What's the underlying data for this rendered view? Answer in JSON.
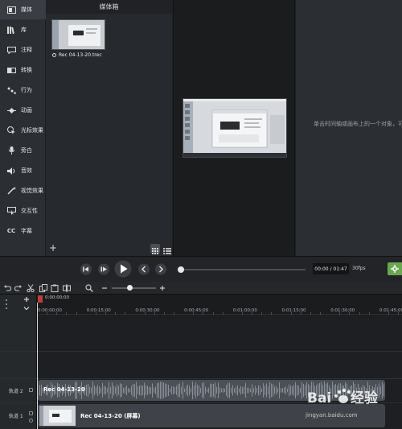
{
  "sidebar": {
    "items": [
      {
        "label": "媒体",
        "icon": "media-icon",
        "active": true
      },
      {
        "label": "库",
        "icon": "library-icon"
      },
      {
        "label": "注释",
        "icon": "annotation-icon"
      },
      {
        "label": "转换",
        "icon": "transition-icon"
      },
      {
        "label": "行为",
        "icon": "behavior-icon"
      },
      {
        "label": "动画",
        "icon": "animation-icon"
      },
      {
        "label": "光标效果",
        "icon": "cursor-effect-icon"
      },
      {
        "label": "旁白",
        "icon": "microphone-icon"
      },
      {
        "label": "音效",
        "icon": "speaker-icon"
      },
      {
        "label": "视觉效果",
        "icon": "magic-wand-icon"
      },
      {
        "label": "交互性",
        "icon": "interactivity-icon"
      },
      {
        "label": "字幕",
        "icon": "captions-icon"
      }
    ]
  },
  "media_bin": {
    "title": "媒体箱",
    "clip_name": "Rec 04-13-20.trec",
    "add_button": "+"
  },
  "properties": {
    "hint": "单击时间轴或画布上的一个对象，可查看其属性。"
  },
  "playback": {
    "time": "00:00 / 01:47",
    "fps": "30fps",
    "position_fraction": 0.0
  },
  "timeline": {
    "playhead_time": "0:00:00;00",
    "zoom_fraction": 0.4,
    "ticks": [
      "0:00:00;00",
      "0:00:15;00",
      "0:00:30;00",
      "0:00:45;00",
      "0:01:00;00",
      "0:01:15;00",
      "0:01:30;00",
      "0:01:45;00"
    ],
    "tracks": [
      {
        "label": "轨道 2",
        "clip": "Rec 04-13-20"
      },
      {
        "label": "轨道 1",
        "clip": "Rec 04-13-20 (屏幕)"
      }
    ]
  },
  "watermark": {
    "brand": "Baidu经验",
    "url": "jingyan.baidu.com"
  },
  "colors": {
    "accent_green": "#6aa84f",
    "playhead_red": "#c23b3b",
    "panel_dark": "#1b1c1e",
    "panel": "#2b2e32"
  }
}
